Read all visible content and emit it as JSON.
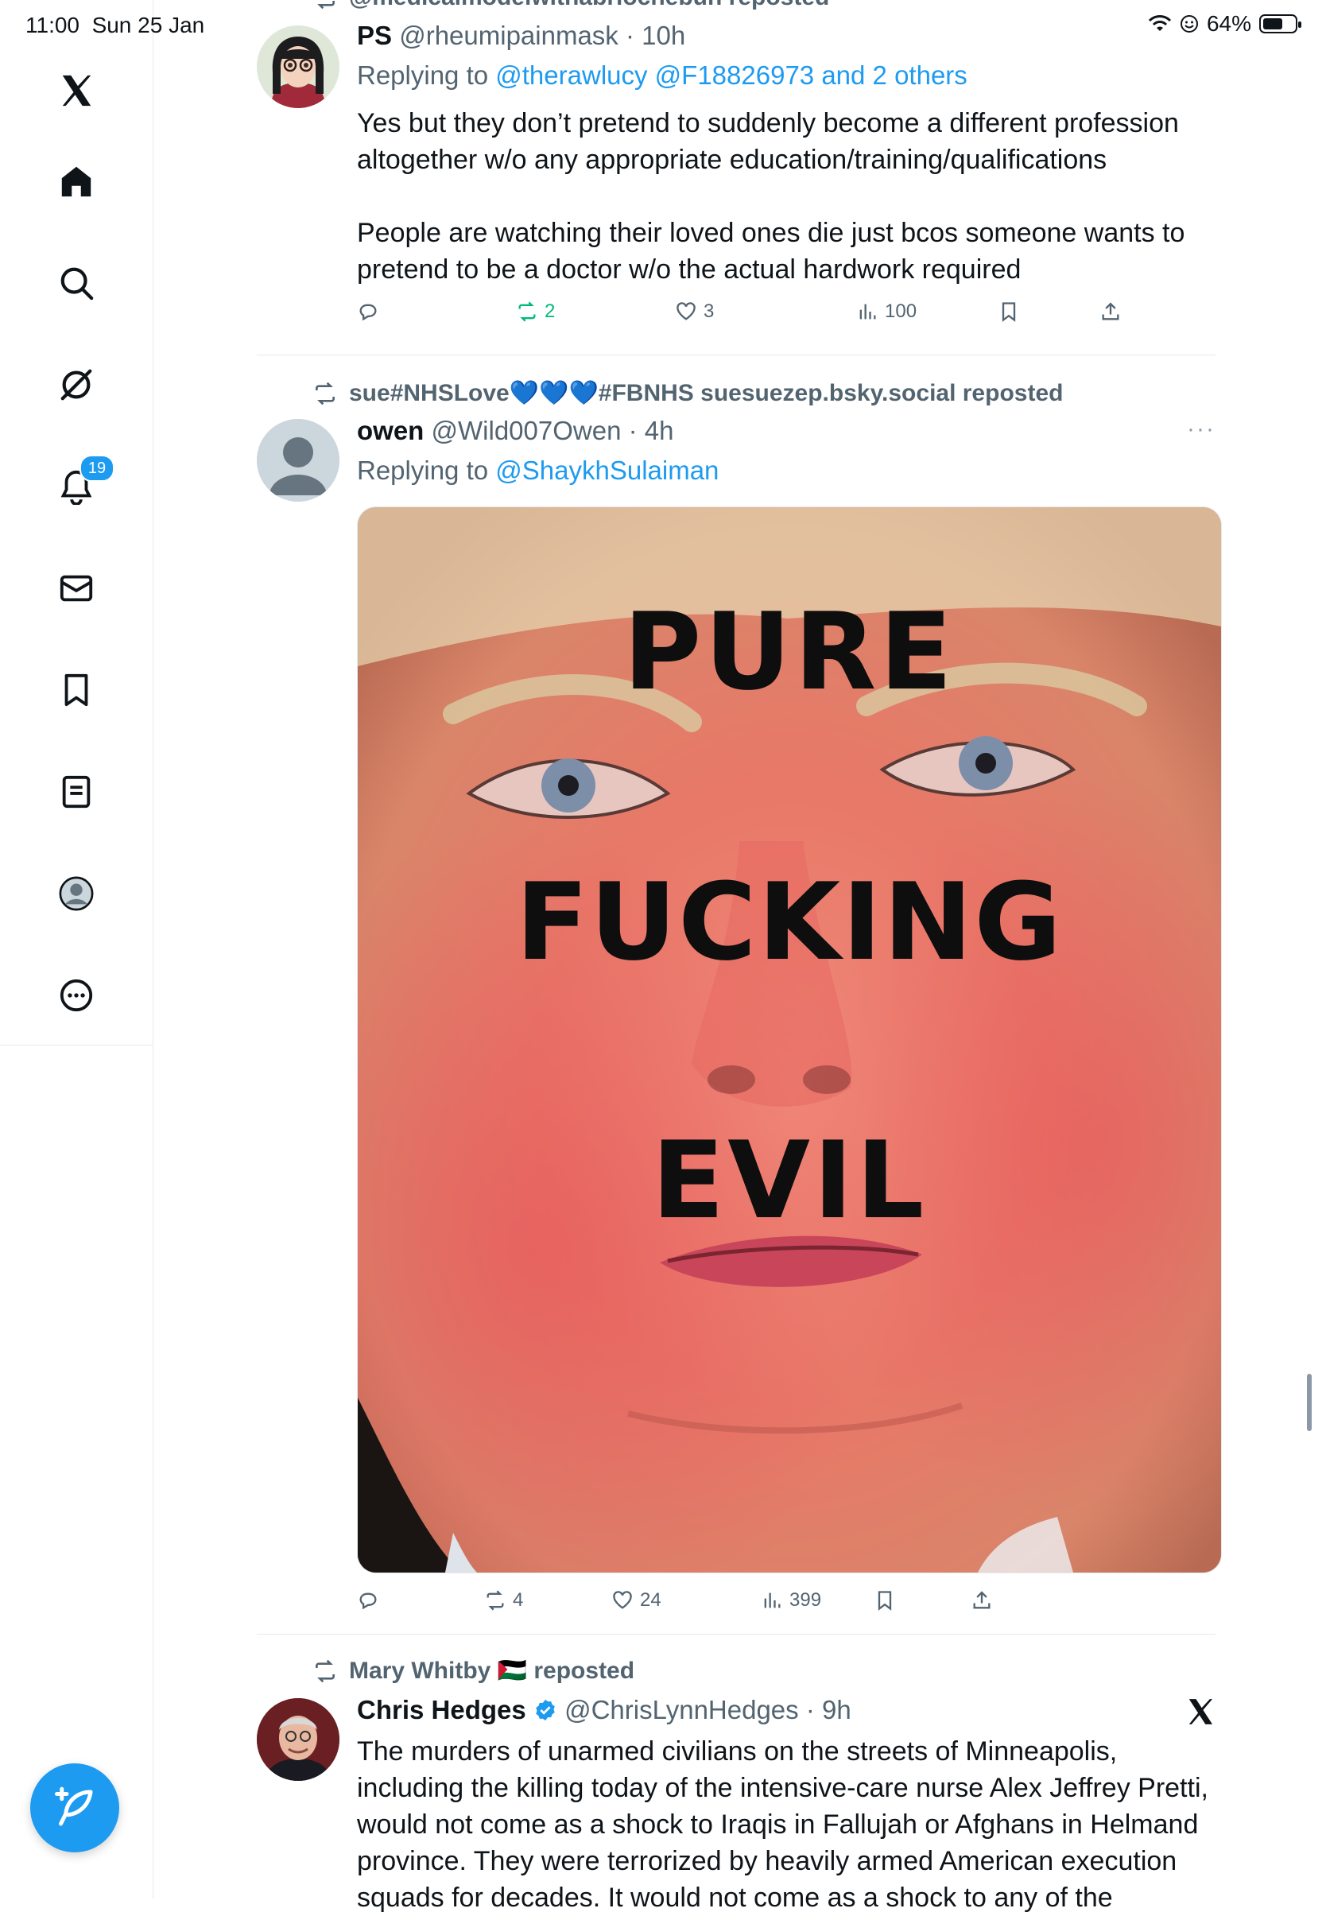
{
  "status": {
    "time": "11:00",
    "date": "Sun 25 Jan",
    "battery": "64%",
    "battery_level": 0.64
  },
  "sidebar": {
    "items": [
      {
        "name": "x-logo"
      },
      {
        "name": "home"
      },
      {
        "name": "search"
      },
      {
        "name": "grok"
      },
      {
        "name": "notifications",
        "badge": "19"
      },
      {
        "name": "messages"
      },
      {
        "name": "bookmarks"
      },
      {
        "name": "lists"
      },
      {
        "name": "profile"
      },
      {
        "name": "more"
      }
    ]
  },
  "posts": [
    {
      "repost_by": "@medicalmodelwithabriochebun reposted",
      "name": "PS",
      "handle": "@rheumipainmask",
      "time": "10h",
      "replying_prefix": "Replying to ",
      "replying_to": "@therawlucy @F18826973 and 2 others",
      "text_p1_l1": "Yes but they don’t pretend to suddenly become a different profession",
      "text_p1_l2": "altogether w/o any appropriate education/training/qualifications",
      "text_p2_l1": "People are watching their loved ones die just bcos someone wants to",
      "text_p2_l2": "pretend to be a doctor w/o the actual hardwork required",
      "reposts": "2",
      "likes": "3",
      "views": "100",
      "reposted_by_me": true
    },
    {
      "repost_by": "sue#NHSLove💙💙💙#FBNHS suesuezep.bsky.social reposted",
      "name": "owen",
      "handle": "@Wild007Owen",
      "time": "4h",
      "replying_prefix": "Replying to ",
      "replying_to": "@ShaykhSulaiman",
      "image_text": [
        "PURE",
        "FUCKING",
        "EVIL"
      ],
      "reposts": "4",
      "likes": "24",
      "views": "399"
    },
    {
      "repost_by": "Mary Whitby 🇵🇸 reposted",
      "name": "Chris Hedges",
      "handle": "@ChrisLynnHedges",
      "time": "9h",
      "verified": true,
      "text_l1": "The murders of unarmed civilians on the streets of Minneapolis,",
      "text_l2": "including the killing today of the intensive-care nurse Alex Jeffrey Pretti,",
      "text_l3": "would not come as a shock to Iraqis in Fallujah or Afghans in Helmand",
      "text_l4": "province. They were terrorized by heavily armed American execution",
      "text_l5": "squads for decades. It would not come as a shock to any of the"
    }
  ],
  "colors": {
    "accent": "#1d9bf0",
    "repost_green": "#00ba7c",
    "secondary": "#536471"
  }
}
